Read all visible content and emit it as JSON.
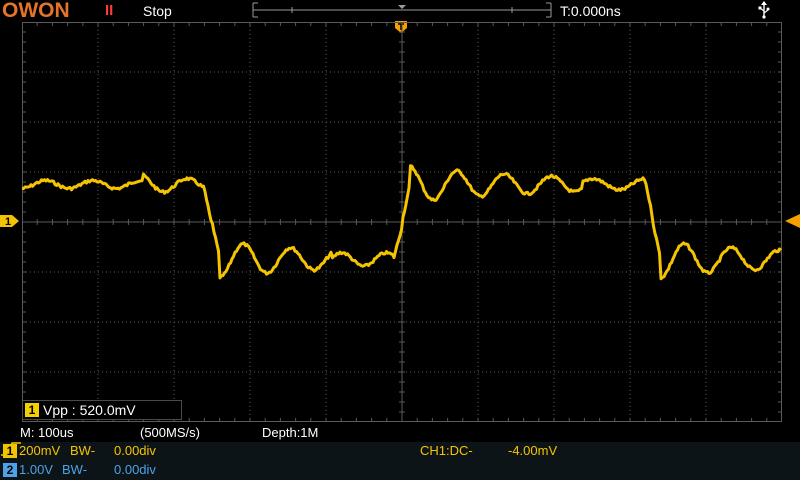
{
  "header": {
    "brand": "OWON",
    "run_status_icon": "II",
    "run_status": "Stop",
    "trigger_time": "T:0.000ns",
    "usb_icon": "usb-icon"
  },
  "measurement": {
    "channel": "1",
    "text": "Vpp : 520.0mV"
  },
  "status": {
    "timebase": "M: 100us",
    "sample_rate": "(500MS/s)",
    "depth": "Depth:1M"
  },
  "channels": [
    {
      "id": "1",
      "scale": "200mV",
      "bw": "BW-",
      "offset": "0.00div",
      "color": "#f5c400"
    },
    {
      "id": "2",
      "scale": "1.00V",
      "bw": "BW-",
      "offset": "0.00div",
      "color": "#4ea2e6"
    }
  ],
  "trigger": {
    "source_coupling": "CH1:DC-",
    "edge_icon": "rising-edge-icon",
    "level": "-4.00mV"
  },
  "colors": {
    "grid": "#5a5a5a",
    "trace": "#f5c400",
    "marker": "#f5a000",
    "brand": "#e57328"
  },
  "waveform": {
    "grid_divisions": [
      10,
      8
    ],
    "high_level_div": 0.75,
    "low_level_div": -0.75,
    "edges_div": [
      {
        "x": 2.5,
        "dir": "fall"
      },
      {
        "x": 5.0,
        "dir": "rise"
      },
      {
        "x": 8.3,
        "dir": "fall"
      }
    ]
  }
}
